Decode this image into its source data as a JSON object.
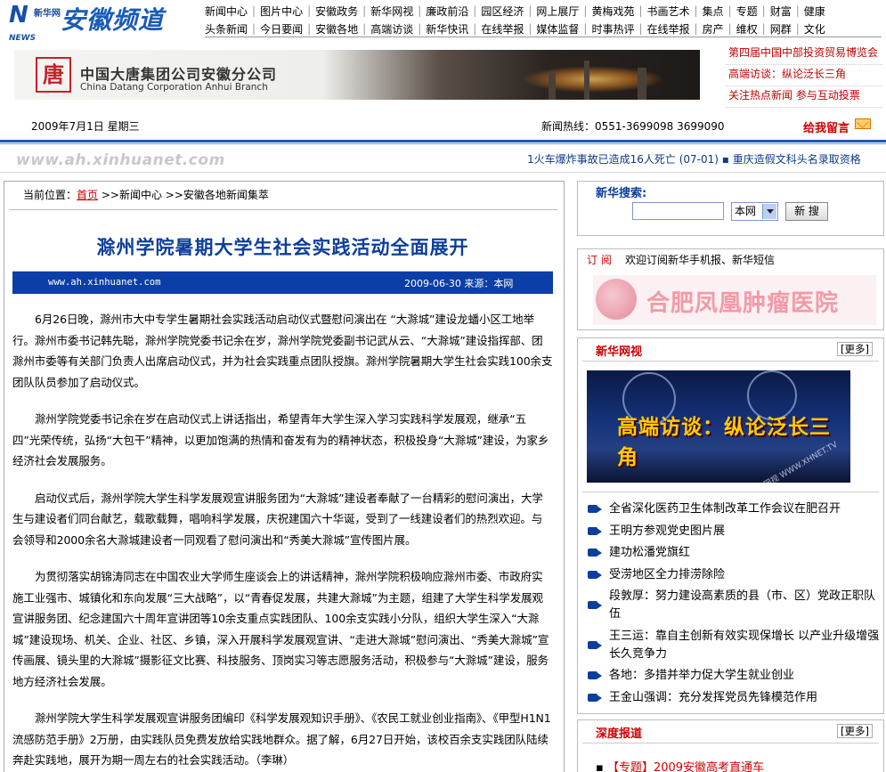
{
  "header": {
    "logo_news": "NEWS",
    "logo_xh": "新华网",
    "channel": "安徽频道",
    "nav_row1": [
      "新闻中心",
      "图片中心",
      "安徽政务",
      "新华网视",
      "廉政前沿",
      "园区经济",
      "网上展厅",
      "黄梅戏苑",
      "书画艺术",
      "集点",
      "专题",
      "财富",
      "健康"
    ],
    "nav_row2": [
      "头条新闻",
      "今日要闻",
      "安徽各地",
      "高端访谈",
      "新华快讯",
      "在线举报",
      "媒体监督",
      "时事热评",
      "在线举报",
      "房产",
      "维权",
      "网群",
      "文化"
    ]
  },
  "banner": {
    "logo_glyph": "唐",
    "cn": "中国大唐集团公司安徽分公司",
    "en": "China Datang Corporation Anhui Branch"
  },
  "right_links": [
    "第四届中国中部投资贸易博览会",
    "高端访谈：纵论泛长三角",
    "关注热点新闻 参与互动投票"
  ],
  "datebar": {
    "date": "2009年7月1日  星期三",
    "hotline": "新闻热线：0551-3699098   3699090",
    "feedback": "给我留言"
  },
  "url_mark": "www.ah.xinhuanet.com",
  "ticker": "1火车爆炸事故已造成16人死亡 (07-01)  ▪  重庆造假文科头名录取资格",
  "breadcrumb": {
    "prefix": "当前位置：",
    "home": "首页",
    "path": ">>新闻中心  >>安徽各地新闻集萃"
  },
  "article": {
    "title": "滁州学院暑期大学生社会实践活动全面展开",
    "source_url": "www.ah.xinhuanet.com",
    "date_source": "2009-06-30    来源：本网",
    "paragraphs": [
      "6月26日晚，滁州市大中专学生暑期社会实践活动启动仪式暨慰问演出在 “大滁城”建设龙蟠小区工地举行。滁州市委书记韩先聪，滁州学院党委书记余在岁，滁州学院党委副书记武从云、“大滁城”建设指挥部、团滁州市委等有关部门负责人出席启动仪式，并为社会实践重点团队授旗。滁州学院暑期大学生社会实践100余支团队队员参加了启动仪式。",
      "滁州学院党委书记余在岁在启动仪式上讲话指出，希望青年大学生深入学习实践科学发展观，继承“五四”光荣传统，弘扬“大包干”精神，以更加饱满的热情和奋发有为的精神状态，积极投身“大滁城”建设，为家乡经济社会发展服务。",
      "启动仪式后，滁州学院大学生科学发展观宣讲服务团为“大滁城”建设者奉献了一台精彩的慰问演出，大学生与建设者们同台献艺，载歌载舞，唱响科学发展，庆祝建国六十华诞，受到了一线建设者们的热烈欢迎。与会领导和2000余名大滁城建设者一同观看了慰问演出和“秀美大滁城”宣传图片展。",
      "为贯彻落实胡锦涛同志在中国农业大学师生座谈会上的讲话精神，滁州学院积极响应滁州市委、市政府实施工业强市、城镇化和东向发展“三大战略”，以“青春促发展，共建大滁城”为主题，组建了大学生科学发展观宣讲服务团、纪念建国六十周年宣讲团等10余支重点实践团队、100余支实践小分队，组织大学生深入“大滁城”建设现场、机关、企业、社区、乡镇，深入开展科学发展观宣讲、“走进大滁城”慰问演出、“秀美大滁城”宣传画展、镜头里的大滁城”摄影征文比赛、科技服务、顶岗实习等志愿服务活动，积极参与“大滁城”建设，服务地方经济社会发展。",
      "滁州学院大学生科学发展观宣讲服务团编印《科学发展观知识手册》、《农民工就业创业指南》、《甲型H1N1流感防范手册》2万册，由实践队员免费发放给实践地群众。据了解，6月27日开始，该校百余支实践团队陆续奔赴实践地，展开为期一周左右的社会实践活动。（李琳）"
    ]
  },
  "search": {
    "label": "新华搜索:",
    "select": "本网",
    "button": "新 搜"
  },
  "subscribe": {
    "tag": "订 阅",
    "text": "欢迎订阅新华手机报、新华短信",
    "hospital": "合肥凤凰肿瘤医院"
  },
  "video": {
    "title": "新华网视",
    "more": "[更多]",
    "poster_text": "高端访谈：纵论泛长三角",
    "poster_watermark": "新华网视 WWW.XHNET.TV",
    "items": [
      "全省深化医药卫生体制改革工作会议在肥召开",
      "王明方参观党史图片展",
      "建功松潘党旗红",
      "受涝地区全力排涝除险",
      "段敦厚：努力建设高素质的县（市、区）党政正职队伍",
      "王三运：靠自主创新有效实现保增长 以产业升级增强长久竞争力",
      "各地：多措并举力促大学生就业创业",
      "王金山强调：充分发挥党员先锋模范作用"
    ]
  },
  "deep": {
    "title": "深度报道",
    "more": "[更多]",
    "item_tag": "【专题】",
    "item": "2009安徽高考直通车"
  }
}
